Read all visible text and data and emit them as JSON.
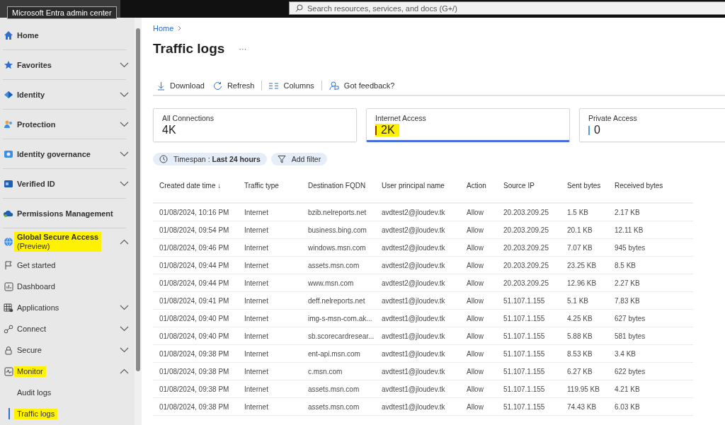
{
  "header": {
    "search": {
      "placeholder": "Search resources, services, and docs (G+/)"
    },
    "tooltip": "Microsoft Entra admin center"
  },
  "sidebar": {
    "items": [
      {
        "label": "Home",
        "highlighted": false
      },
      {
        "label": "Favorites",
        "expanded": false,
        "highlighted": false
      },
      {
        "label": "Identity",
        "expanded": false,
        "highlighted": false
      },
      {
        "label": "Protection",
        "expanded": false,
        "highlighted": false
      },
      {
        "label": "Identity governance",
        "expanded": false,
        "highlighted": false
      },
      {
        "label": "Verified ID",
        "expanded": false,
        "highlighted": false
      },
      {
        "label": "Permissions Management",
        "highlighted": false
      },
      {
        "label": "Global Secure Access",
        "sublabel": "(Preview)",
        "expanded": true,
        "highlighted": true,
        "children": [
          {
            "label": "Get started",
            "highlighted": false
          },
          {
            "label": "Dashboard",
            "highlighted": false
          },
          {
            "label": "Applications",
            "expanded": false,
            "highlighted": false
          },
          {
            "label": "Connect",
            "expanded": false,
            "highlighted": false
          },
          {
            "label": "Secure",
            "expanded": false,
            "highlighted": false
          },
          {
            "label": "Monitor",
            "expanded": true,
            "highlighted": true,
            "children": [
              {
                "label": "Audit logs",
                "selected": false,
                "highlighted": false
              },
              {
                "label": "Traffic logs",
                "selected": true,
                "highlighted": true
              }
            ]
          }
        ]
      }
    ]
  },
  "breadcrumb": [
    "Home"
  ],
  "page": {
    "title": "Traffic logs",
    "more": "···"
  },
  "toolbar": [
    {
      "label": "Download",
      "kind": "download"
    },
    {
      "label": "Refresh",
      "kind": "refresh"
    },
    {
      "label": "Columns",
      "kind": "columns"
    },
    {
      "label": "Got feedback?",
      "kind": "feedback"
    }
  ],
  "cards": [
    {
      "label": "All Connections",
      "value": "4K",
      "selected": false,
      "highlighted": false
    },
    {
      "label": "Internet Access",
      "value": "2K",
      "color": "#8a3b00",
      "selected": true,
      "highlighted": true
    },
    {
      "label": "Private Access",
      "value": "0",
      "color": "#5b9bd5",
      "selected": false,
      "highlighted": false
    }
  ],
  "filters": [
    {
      "label": "Timespan : ",
      "value": "Last 24 hours",
      "kind": "timespan"
    },
    {
      "label": "Add filter",
      "kind": "add"
    }
  ],
  "table": {
    "columns": [
      "Created date time ↓",
      "Traffic type",
      "Destination FQDN",
      "User principal name",
      "Action",
      "Source IP",
      "Sent bytes",
      "Received bytes"
    ],
    "rows": [
      [
        "01/08/2024, 10:16 PM",
        "Internet",
        "bzib.nelreports.net",
        "avdtest2@jloudev.tk",
        "Allow",
        "20.203.209.25",
        "1.5 KB",
        "2.17 KB"
      ],
      [
        "01/08/2024, 09:54 PM",
        "Internet",
        "business.bing.com",
        "avdtest2@jloudev.tk",
        "Allow",
        "20.203.209.25",
        "20.1 KB",
        "12.11 KB"
      ],
      [
        "01/08/2024, 09:46 PM",
        "Internet",
        "windows.msn.com",
        "avdtest2@jloudev.tk",
        "Allow",
        "20.203.209.25",
        "7.07 KB",
        "945 bytes"
      ],
      [
        "01/08/2024, 09:44 PM",
        "Internet",
        "assets.msn.com",
        "avdtest2@jloudev.tk",
        "Allow",
        "20.203.209.25",
        "23.25 KB",
        "8.5 KB"
      ],
      [
        "01/08/2024, 09:44 PM",
        "Internet",
        "www.msn.com",
        "avdtest2@jloudev.tk",
        "Allow",
        "20.203.209.25",
        "12.96 KB",
        "2.27 KB"
      ],
      [
        "01/08/2024, 09:41 PM",
        "Internet",
        "deff.nelreports.net",
        "avdtest1@jloudev.tk",
        "Allow",
        "51.107.1.155",
        "5.1 KB",
        "7.83 KB"
      ],
      [
        "01/08/2024, 09:40 PM",
        "Internet",
        "img-s-msn-com.ak...",
        "avdtest1@jloudev.tk",
        "Allow",
        "51.107.1.155",
        "4.25 KB",
        "627 bytes"
      ],
      [
        "01/08/2024, 09:40 PM",
        "Internet",
        "sb.scorecardresear...",
        "avdtest1@jloudev.tk",
        "Allow",
        "51.107.1.155",
        "5.88 KB",
        "581 bytes"
      ],
      [
        "01/08/2024, 09:38 PM",
        "Internet",
        "ent-api.msn.com",
        "avdtest1@jloudev.tk",
        "Allow",
        "51.107.1.155",
        "8.53 KB",
        "3.4 KB"
      ],
      [
        "01/08/2024, 09:38 PM",
        "Internet",
        "c.msn.com",
        "avdtest1@jloudev.tk",
        "Allow",
        "51.107.1.155",
        "6.27 KB",
        "622 bytes"
      ],
      [
        "01/08/2024, 09:38 PM",
        "Internet",
        "assets.msn.com",
        "avdtest1@jloudev.tk",
        "Allow",
        "51.107.1.155",
        "119.95 KB",
        "4.21 KB"
      ],
      [
        "01/08/2024, 09:38 PM",
        "Internet",
        "assets.msn.com",
        "avdtest1@jloudev.tk",
        "Allow",
        "51.107.1.155",
        "74.43 KB",
        "6.03 KB"
      ]
    ]
  }
}
